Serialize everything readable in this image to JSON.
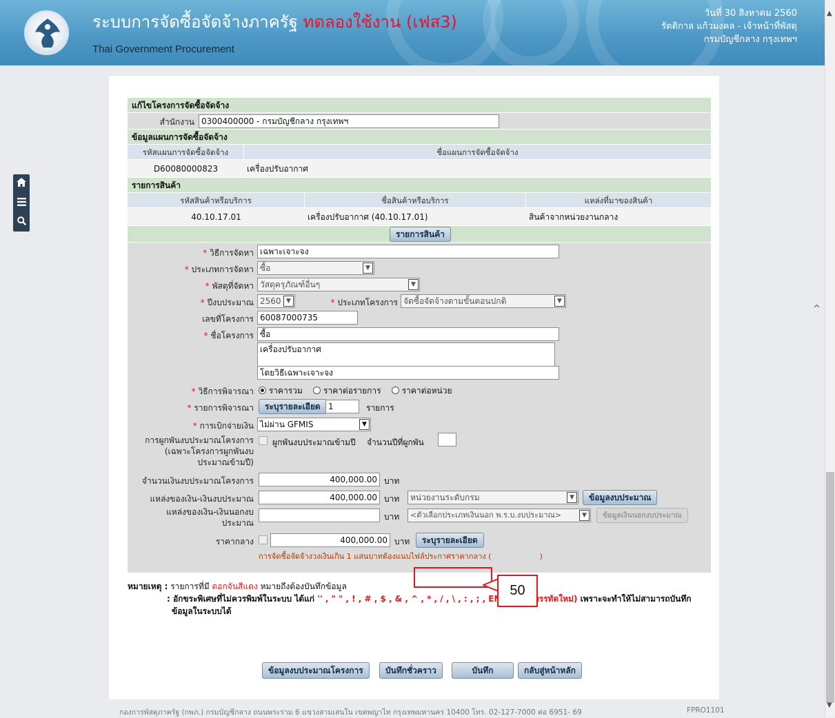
{
  "header": {
    "title_main": "ระบบการจัดซื้อจัดจ้างภาครัฐ",
    "title_trial": "ทดลองใช้งาน (เฟส3)",
    "subtitle_en": "Thai Government Procurement",
    "date": "วันที่ 30 สิงหาคม 2560",
    "user": "รัตติกาล แก้วมงคล - เจ้าหน้าที่พัสดุ",
    "org": "กรมบัญชีกลาง กรุงเทพฯ"
  },
  "nav": {
    "home_icon": "home-icon",
    "menu_icon": "menu-icon",
    "search_icon": "search-icon"
  },
  "form": {
    "section_edit": "แก้ไขโครงการจัดซื้อจัดจ้าง",
    "office_label": "สำนักงาน",
    "office_value": "0300400000 - กรมบัญชีกลาง กรุงเทพฯ",
    "section_plan": "ข้อมูลแผนการจัดซื้อจัดจ้าง",
    "plan_headers": [
      "รหัสแผนการจัดซื้อจัดจ้าง",
      "ชื่อแผนการจัดซื้อจัดจ้าง"
    ],
    "plan_row": [
      "D60080000823",
      "เครื่องปรับอากาศ"
    ],
    "section_items": "รายการสินค้า",
    "item_headers": [
      "รหัสสินค้าหรือบริการ",
      "ชื่อสินค้าหรือบริการ",
      "แหล่งที่มาของสินค้า"
    ],
    "item_row": [
      "40.10.17.01",
      "เครื่องปรับอากาศ (40.10.17.01)",
      "สินค้าจากหน่วยงานกลาง"
    ],
    "items_button": "รายการสินค้า",
    "method_label": "วิธีการจัดหา",
    "method_value": "เฉพาะเจาะจง",
    "type_label": "ประเภทการจัดหา",
    "type_value": "ซื้อ",
    "supply_label": "พัสดุที่จัดหา",
    "supply_value": "วัสดุครุภัณฑ์อื่นๆ",
    "year_label": "ปีงบประมาณ",
    "year_value": "2560",
    "project_type_label": "ประเภทโครงการ",
    "project_type_value": "จัดซื้อจัดจ้างตามขั้นตอนปกติ",
    "project_no_label": "เลขที่โครงการ",
    "project_no_value": "60087000735",
    "project_name_label": "ชื่อโครงการ",
    "project_name_1": "ซื้อ",
    "project_name_2": "เครื่องปรับอากาศ",
    "project_name_3": "โดยวิธีเฉพาะเจาะจง",
    "consider_method_label": "วิธีการพิจารณา",
    "consider_options": [
      "ราคารวม",
      "ราคาต่อรายการ",
      "ราคาต่อหน่วย"
    ],
    "consider_items_label": "รายการพิจารณา",
    "detail_button": "ระบุรายละเอียด",
    "consider_items_count": "1",
    "consider_items_unit": "รายการ",
    "disburse_label": "การเบิกจ่ายเงิน",
    "disburse_value": "ไม่ผ่าน GFMIS",
    "multi_year_label": "การผูกพันงบประมาณโครงการ",
    "multi_year_sub": "(เฉพาะโครงการผูกพันงบประมาณข้ามปี)",
    "multi_year_checkbox": "ผูกพันงบประมาณข้ามปี",
    "multi_year_count_label": "จำนวนปีที่ผูกพัน",
    "budget_label": "จำนวนเงินงบประมาณโครงการ",
    "budget_value": "400,000.00",
    "baht": "บาท",
    "source_budget_label": "แหล่งของเงิน-เงินงบประมาณ",
    "source_budget_value": "400,000.00",
    "source_budget_unit": "หน่วยงานระดับกรม",
    "budget_info_button": "ข้อมูลงบประมาณ",
    "source_offbudget_label": "แหล่งของเงิน-เงินนอกงบประมาณ",
    "source_offbudget_select": "<ตัวเลือกประเภทเงินนอก พ.ร.บ.งบประมาณ>",
    "offbudget_info_button": "ข้อมูลเงินนอกงบประมาณ",
    "median_price_label": "ราคากลาง",
    "median_price_value": "400,000.00",
    "median_detail_button": "ระบุรายละเอียด",
    "median_warning": "การจัดซื้อจัดจ้างวงเงินเกิน 1 แสนบาทต้องแนบไฟล์ประกาศราคากลาง (",
    "median_warning_end": ")"
  },
  "notes": {
    "prefix": "หมายเหตุ :",
    "line1_a": "รายการที่มี",
    "line1_red": "ดอกจันสีแดง",
    "line1_b": "หมายถึงต้องบันทึกข้อมูล",
    "line2_a": ": อักขระพิเศษที่ไม่ควรพิมพ์ในระบบ ได้แก่",
    "line2_red": "'' , \" \" , ! , # , $ , & , ^ , * , / , \\ , : , ; , ENTER(ขึ้นบรรทัดใหม่)",
    "line2_b": "เพราะจะทำให้ไม่สามารถบันทึก",
    "line3": "ข้อมูลในระบบได้"
  },
  "actions": {
    "budget_project": "ข้อมูลงบประมาณโครงการ",
    "save_draft": "บันทึกชั่วคราว",
    "save": "บันทึก",
    "back_home": "กลับสู่หน้าหลัก"
  },
  "callout": {
    "step": "50"
  },
  "footer": {
    "text": "กองการพัสดุภาครัฐ (กพภ.) กรมบัญชีกลาง ถนนพระราม 6 แขวงสามเสนใน เขตพญาไท กรุงเทพมหานคร 10400 โทร. 02-127-7000 ต่อ 6951- 69",
    "code": "FPRO1101"
  },
  "colors": {
    "header": "#4c97c4",
    "trial": "#e8132c",
    "section": "#d0e3cd",
    "callout": "#e0161b"
  }
}
